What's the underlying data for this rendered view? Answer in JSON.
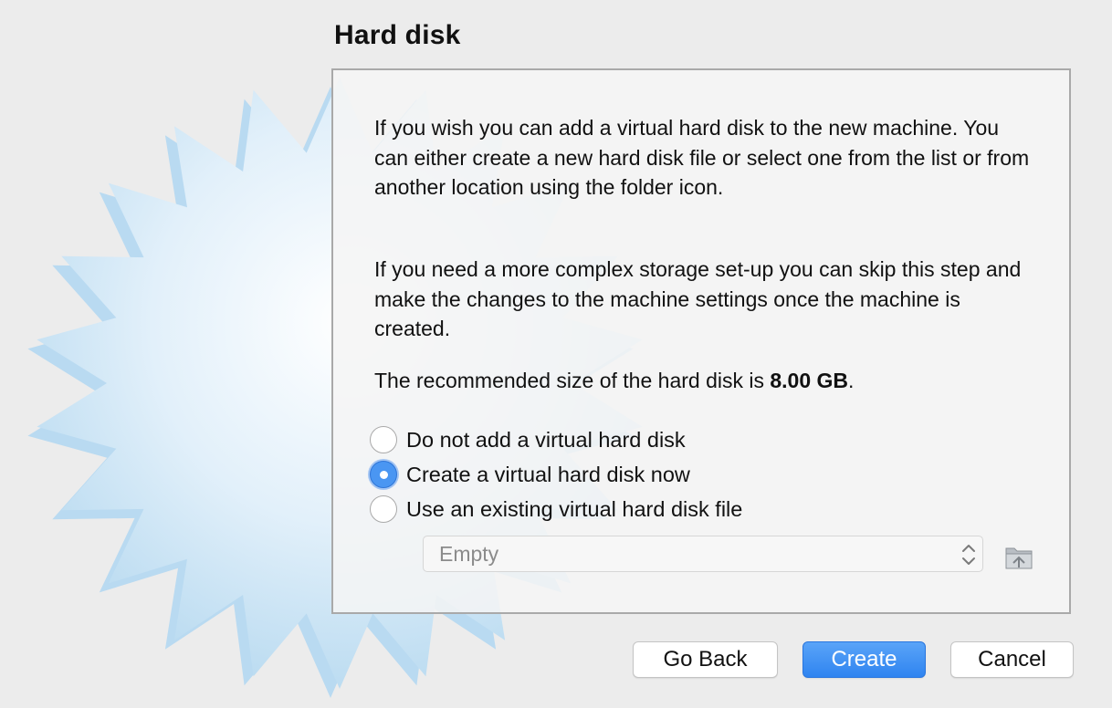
{
  "title": "Hard disk",
  "description": {
    "para1": "If you wish you can add a virtual hard disk to the new machine. You can either create a new hard disk file or select one from the list or from another location using the folder icon.",
    "para2": "If you need a more complex storage set-up you can skip this step and make the changes to the machine settings once the machine is created.",
    "para3_prefix": "The recommended size of the hard disk is ",
    "recommended_size": "8.00 GB",
    "para3_suffix": "."
  },
  "options": [
    {
      "label": "Do not add a virtual hard disk",
      "selected": false
    },
    {
      "label": "Create a virtual hard disk now",
      "selected": true
    },
    {
      "label": "Use an existing virtual hard disk file",
      "selected": false
    }
  ],
  "disk_select": {
    "value": "Empty"
  },
  "icons": {
    "background": "starburst-icon",
    "select_arrows": "up-down-chevron-icon",
    "folder": "folder-icon"
  },
  "buttons": {
    "back": "Go Back",
    "create": "Create",
    "cancel": "Cancel"
  },
  "colors": {
    "accent": "#3b8ef3",
    "background": "#ececec",
    "starburst": "#cfe6f6"
  }
}
